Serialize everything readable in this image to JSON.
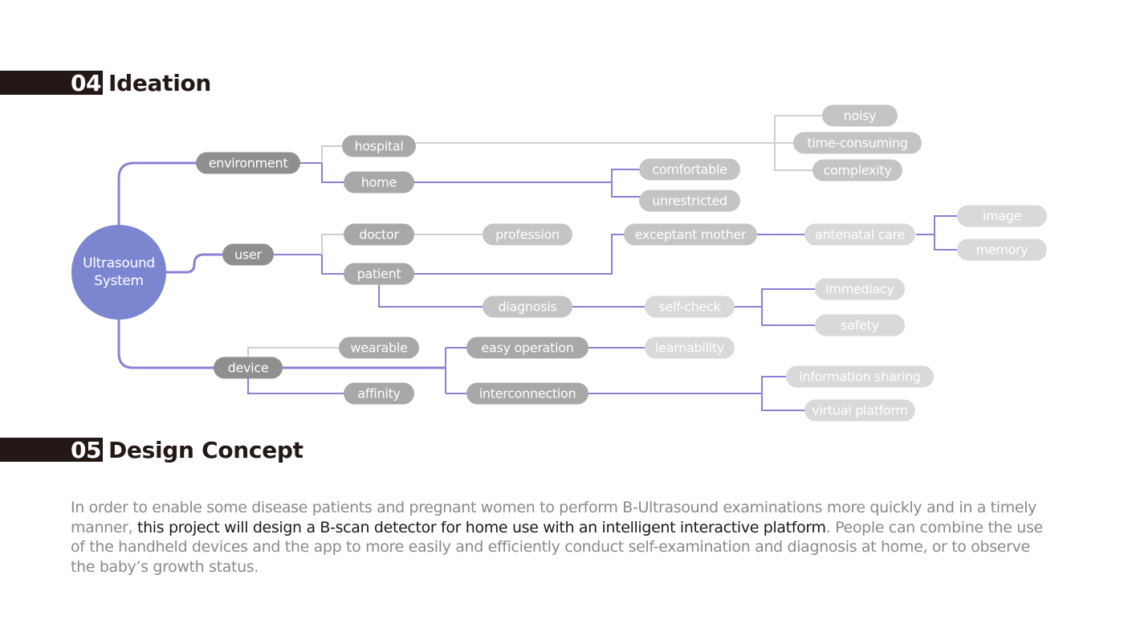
{
  "sections": {
    "ideation": {
      "number": "04",
      "title": "Ideation"
    },
    "concept": {
      "number": "05",
      "title": "Design Concept"
    }
  },
  "colors": {
    "accent": "#7b86d1",
    "connector_active": "#8b80d4",
    "connector_inactive": "#cfcfcf",
    "header_block": "#231815",
    "node_level1": "#8f8f8f",
    "node_level2": "#a8a8a8",
    "node_level3": "#c4c4c4",
    "node_level4": "#d9d9d9"
  },
  "mindmap": {
    "root": {
      "line1": "Ultrasound",
      "line2": "System"
    },
    "nodes": {
      "environment": "environment",
      "user": "user",
      "device": "device",
      "hospital": "hospital",
      "home": "home",
      "doctor": "doctor",
      "patient": "patient",
      "wearable": "wearable",
      "affinity": "affinity",
      "noisy": "noisy",
      "time_consuming": "time-consuming",
      "complexity": "complexity",
      "comfortable": "comfortable",
      "unrestricted": "unrestricted",
      "profession": "profession",
      "exceptant_mother": "exceptant mother",
      "antenatal_care": "antenatal care",
      "image": "image",
      "memory": "memory",
      "diagnosis": "diagnosis",
      "self_check": "self-check",
      "immediacy": "immediacy",
      "safety": "safety",
      "easy_operation": "easy operation",
      "learnability": "learnability",
      "interconnection": "interconnection",
      "information_sharing": "information sharing",
      "virtual_platform": "virtual platform"
    }
  },
  "concept": {
    "text_before": "In order to enable some disease patients and pregnant women to perform B-Ultrasound examinations more quickly and in a timely manner, ",
    "text_highlight": "this project will design a B-scan detector for home use with an intelligent interactive platform",
    "text_after": ". People can combine the use of the handheld devices and the app to more easily and efficiently conduct self-examination and diagnosis at home, or to observe the baby’s growth status."
  }
}
